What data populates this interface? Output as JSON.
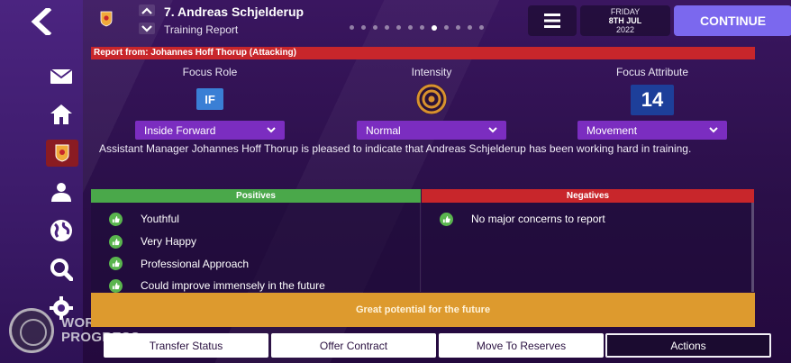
{
  "header": {
    "player_name": "7. Andreas Schjelderup",
    "report_type": "Training Report",
    "page_dots": 12,
    "active_dot": 8,
    "date_day": "FRIDAY",
    "date_date": "8TH JUL",
    "date_year": "2022",
    "continue_label": "CONTINUE"
  },
  "report": {
    "source": "Report from: Johannes Hoff Thorup (Attacking)",
    "focus_role": {
      "label": "Focus Role",
      "badge": "IF",
      "value": "Inside Forward"
    },
    "intensity": {
      "label": "Intensity",
      "value": "Normal"
    },
    "focus_attribute": {
      "label": "Focus Attribute",
      "badge": "14",
      "value": "Movement"
    },
    "description": "Assistant Manager Johannes Hoff Thorup is pleased to indicate that Andreas Schjelderup has been working hard in training."
  },
  "positives": {
    "title": "Positives",
    "items": [
      "Youthful",
      "Very Happy",
      "Professional Approach",
      "Could improve immensely in the future"
    ]
  },
  "negatives": {
    "title": "Negatives",
    "items": [
      "No major concerns to report"
    ]
  },
  "potential": "Great potential for the future",
  "buttons": {
    "transfer_status": "Transfer Status",
    "offer_contract": "Offer Contract",
    "move_to_reserves": "Move To Reserves",
    "actions": "Actions"
  },
  "watermark": "WORK IN PROGRESS",
  "colors": {
    "accent": "#7b68ee",
    "positive": "#4aa84a",
    "negative": "#c8262b",
    "potential": "#dd9a2e",
    "dropdown": "#7b2dc0"
  },
  "icons": [
    "back-arrow-icon",
    "mail-icon",
    "home-icon",
    "club-crest-icon",
    "people-icon",
    "globe-icon",
    "search-icon",
    "settings-icon",
    "menu-icon",
    "thumbs-up-icon"
  ]
}
